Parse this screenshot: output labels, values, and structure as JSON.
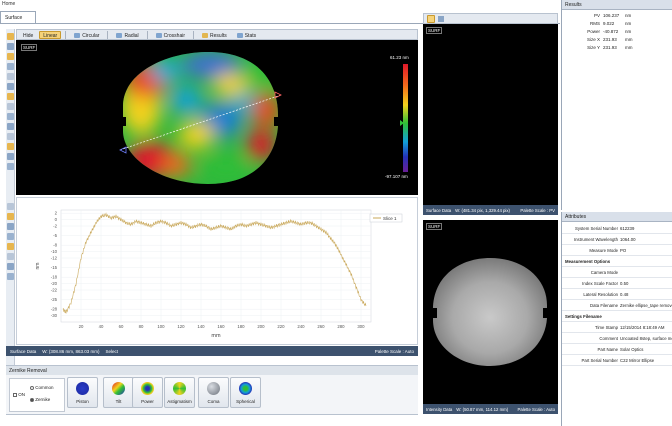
{
  "app": {
    "home_label": "Home",
    "tab": "Surface"
  },
  "toolbar": {
    "items": [
      {
        "label": "Hide",
        "active": false
      },
      {
        "label": "Linear",
        "active": true
      },
      {
        "label": "Circular",
        "active": false
      },
      {
        "label": "Radial",
        "active": false
      },
      {
        "label": "Crosshair",
        "active": false
      },
      {
        "label": "Results",
        "active": false
      },
      {
        "label": "Stats",
        "active": false
      }
    ]
  },
  "surface_view": {
    "label": "SURF",
    "scale_max": "61.23 nm",
    "scale_min": "-97.107 nm"
  },
  "chart_data": {
    "type": "line",
    "title": "",
    "xlabel": "mm",
    "ylabel": "nm",
    "xlim": [
      0,
      310
    ],
    "ylim": [
      -32,
      3
    ],
    "x_ticks": [
      20,
      40,
      60,
      80,
      100,
      120,
      140,
      160,
      180,
      200,
      220,
      240,
      260,
      280,
      300
    ],
    "y_ticks": [
      2,
      0,
      -2,
      -5,
      -8,
      -10,
      -12,
      -15,
      -18,
      -20,
      -22,
      -25,
      -28,
      -30
    ],
    "legend": "top-right",
    "series": [
      {
        "name": "Slice 1",
        "color": "#c9a85a",
        "x": [
          2,
          5,
          10,
          15,
          20,
          25,
          30,
          35,
          40,
          45,
          50,
          55,
          60,
          65,
          70,
          75,
          80,
          85,
          90,
          95,
          100,
          105,
          110,
          115,
          120,
          125,
          130,
          135,
          140,
          145,
          150,
          155,
          160,
          165,
          170,
          175,
          180,
          185,
          190,
          195,
          200,
          205,
          210,
          215,
          220,
          225,
          230,
          235,
          240,
          245,
          250,
          255,
          260,
          265,
          270,
          275,
          280,
          285,
          290,
          295,
          300,
          305
        ],
        "y": [
          -28,
          -29,
          -26,
          -20,
          -12,
          -7,
          -4,
          -1,
          1,
          1.5,
          0.5,
          1,
          0,
          -1,
          -1.5,
          -0.5,
          -1,
          -1.5,
          -2,
          -1,
          -0.5,
          -1,
          -2,
          -1.5,
          -1,
          -1.5,
          -2.5,
          -2,
          -1.5,
          -2,
          -3,
          -2.5,
          -2,
          -2.5,
          -3,
          -2,
          -1.5,
          -2,
          -1.5,
          -1,
          -1.5,
          -2,
          -2.5,
          -2,
          -1.5,
          -1,
          -0.5,
          -1,
          -1.5,
          -1,
          -1,
          -2,
          -3,
          -4,
          -6,
          -8,
          -11,
          -14,
          -17,
          -21,
          -25,
          -27
        ]
      }
    ]
  },
  "main_status": {
    "left": "Surface Data",
    "coords": "W: (308.86 mm, 863.03 mm)",
    "mode": "Select",
    "right": "Palette Scale : Auto"
  },
  "zernike": {
    "title": "Zernike Removal",
    "radio_on_label": "ON",
    "radio_options": [
      "Common",
      "Zernike"
    ],
    "buttons": [
      {
        "label": "Piston",
        "icon": "piston-icon"
      },
      {
        "label": "Tilt",
        "icon": "tilt-icon"
      },
      {
        "label": "Power",
        "icon": "power-icon"
      },
      {
        "label": "Astigmatism",
        "icon": "astigmatism-icon"
      },
      {
        "label": "Coma",
        "icon": "coma-icon"
      },
      {
        "label": "Spherical",
        "icon": "spherical-icon"
      }
    ]
  },
  "small_views": {
    "top_label": "SURF",
    "top_status_left": "Surface Data",
    "top_status_coords": "W: (481.34 pix, 1,329.44 pix)",
    "top_status_right": "Palette Scale : PV",
    "bottom_label": "SURF",
    "bottom_status_left": "Intensity Data",
    "bottom_status_coords": "W: (50.87 mm, 114.12 mm)",
    "bottom_status_right": "Palette Scale : Auto"
  },
  "results": {
    "title": "Results",
    "rows": [
      {
        "label": "PV",
        "value": "106.237",
        "unit": "nm"
      },
      {
        "label": "RMS",
        "value": "9.022",
        "unit": "nm"
      },
      {
        "label": "Power",
        "value": "-40.872",
        "unit": "nm"
      },
      {
        "label": "Size X",
        "value": "231.93",
        "unit": "mm"
      },
      {
        "label": "Size Y",
        "value": "231.93",
        "unit": "mm"
      }
    ]
  },
  "attributes": {
    "title": "Attributes",
    "rows": [
      {
        "key": "System Serial Number",
        "value": "612239",
        "section": false
      },
      {
        "key": "Instrument Wavelength",
        "value": "1064.00",
        "section": false
      },
      {
        "key": "Measure Mode",
        "value": "PO",
        "section": false
      },
      {
        "key": "Measurement Options",
        "value": "",
        "section": true
      },
      {
        "key": "Camera Mode",
        "value": "",
        "section": false
      },
      {
        "key": "Index Scale Factor",
        "value": "0.50",
        "section": false
      },
      {
        "key": "Lateral Resolution",
        "value": "0.48",
        "section": false
      },
      {
        "key": "Data Filename",
        "value": "Zernike ellipse_tape removed.datx",
        "section": false
      },
      {
        "key": "Settings Filename",
        "value": "",
        "section": true
      },
      {
        "key": "Time Stamp",
        "value": "12/15/2014 8:18:49 AM",
        "section": false
      },
      {
        "key": "Comment",
        "value": "Uncoated 8step, surface model",
        "section": false
      },
      {
        "key": "Part Name",
        "value": "Solar Optics",
        "section": false
      },
      {
        "key": "Part Serial Number",
        "value": "C22 Mirror Ellipse",
        "section": false
      }
    ]
  }
}
